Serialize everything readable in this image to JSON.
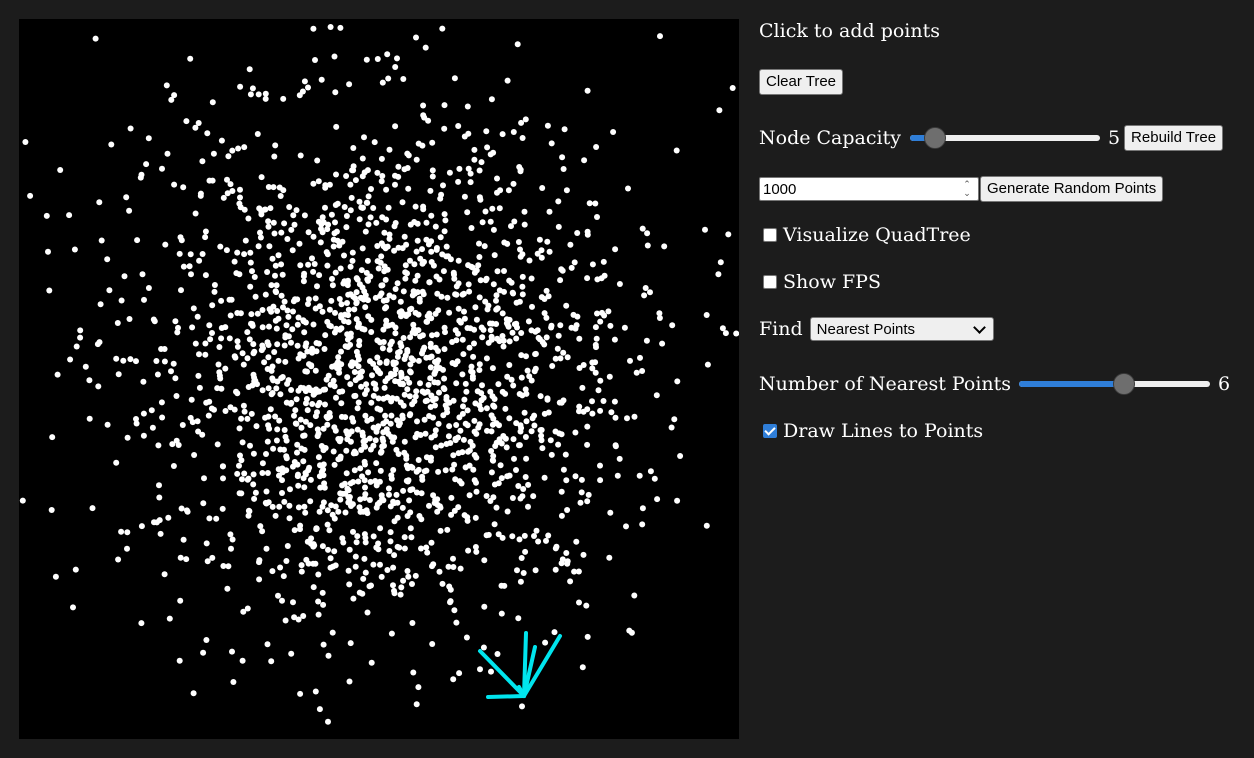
{
  "canvas": {
    "background": "#000000",
    "point_color": "#ffffff",
    "line_color": "#00e5ee"
  },
  "panel": {
    "instructions": "Click to add points",
    "clear_tree_label": "Clear Tree",
    "node_capacity": {
      "label": "Node Capacity",
      "value": "5",
      "slider_fraction": 0.13
    },
    "rebuild_tree_label": "Rebuild Tree",
    "random_count_value": "1000",
    "generate_label": "Generate Random Points",
    "visualize_quadtree": {
      "label": "Visualize QuadTree",
      "checked": false
    },
    "show_fps": {
      "label": "Show FPS",
      "checked": false
    },
    "find": {
      "label": "Find",
      "selected": "Nearest Points",
      "icon": "chevron-down-icon"
    },
    "nearest_count": {
      "label": "Number of Nearest Points",
      "value": "6",
      "slider_fraction": 0.55
    },
    "draw_lines": {
      "label": "Draw Lines to Points",
      "checked": true
    }
  },
  "colors": {
    "page_background": "#1c1c1c",
    "accent": "#2f7ed8"
  }
}
